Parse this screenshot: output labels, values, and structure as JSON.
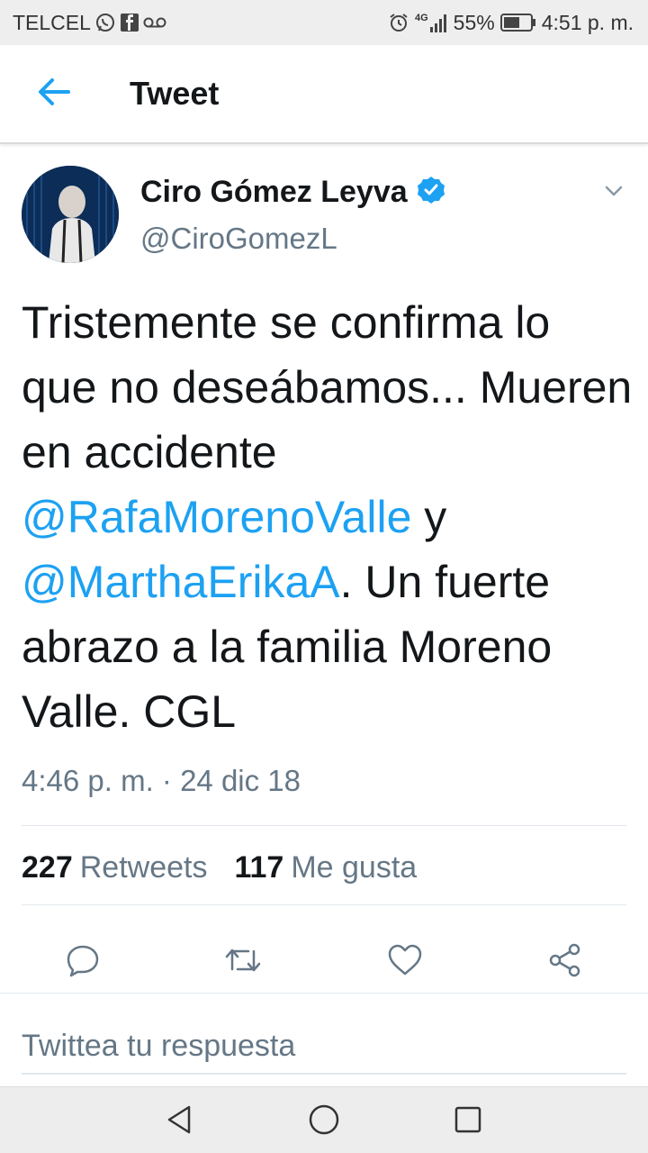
{
  "status_bar": {
    "carrier": "TELCEL",
    "network": "4G",
    "battery": "55%",
    "time": "4:51 p. m.",
    "icons": [
      "whatsapp-icon",
      "facebook-icon",
      "voicemail-icon",
      "alarm-icon",
      "signal-icon",
      "battery-icon"
    ]
  },
  "header": {
    "title": "Tweet",
    "back_icon": "arrow-left-icon",
    "accent": "#1da1f2"
  },
  "tweet": {
    "author_name": "Ciro Gómez Leyva",
    "verified": true,
    "handle": "@CiroGomezL",
    "text_parts": {
      "p1": "Tristemente se confirma lo que no deseábamos... Mueren en accidente ",
      "mention1": "@RafaMorenoValle",
      "p2": " y ",
      "mention2": "@MarthaErikaA",
      "p3": ". Un fuerte abrazo a la familia Moreno Valle. CGL"
    },
    "timestamp": "4:46 p. m. · 24 dic 18",
    "retweets_count": "227",
    "retweets_label": "Retweets",
    "likes_count": "117",
    "likes_label": "Me gusta"
  },
  "actions": [
    "reply-icon",
    "retweet-icon",
    "like-icon",
    "share-icon"
  ],
  "reply": {
    "placeholder": "Twittea tu respuesta"
  },
  "nav": [
    "back-triangle-icon",
    "home-circle-icon",
    "recents-square-icon"
  ],
  "colors": {
    "text": "#14171a",
    "secondary": "#657786",
    "link": "#1da1f2",
    "divider": "#e1e8ed"
  }
}
